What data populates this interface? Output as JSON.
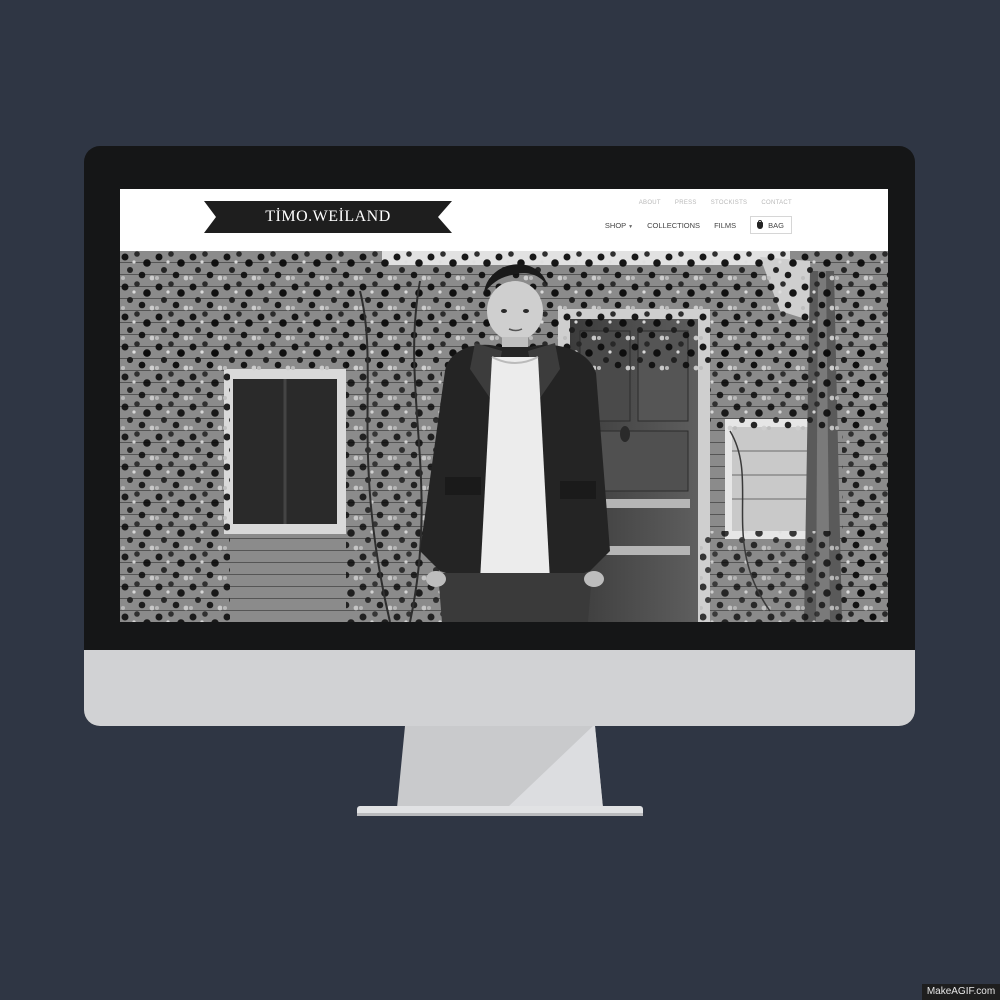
{
  "site": {
    "logo": "TİMO.WEİLAND",
    "top_nav": [
      "ABOUT",
      "PRESS",
      "STOCKISTS",
      "CONTACT"
    ],
    "main_nav": {
      "shop": "SHOP",
      "collections": "COLLECTIONS",
      "films": "FILMS",
      "bag": "BAG"
    },
    "icons": {
      "bag": "shopping-bag-icon",
      "shop_caret": "chevron-down-icon"
    }
  },
  "watermark": "MakeAGIF.com",
  "colors": {
    "background": "#2f3644",
    "monitor_bezel": "#151617",
    "monitor_chin": "#d1d2d4",
    "logo_ribbon": "#1e1e1e"
  }
}
